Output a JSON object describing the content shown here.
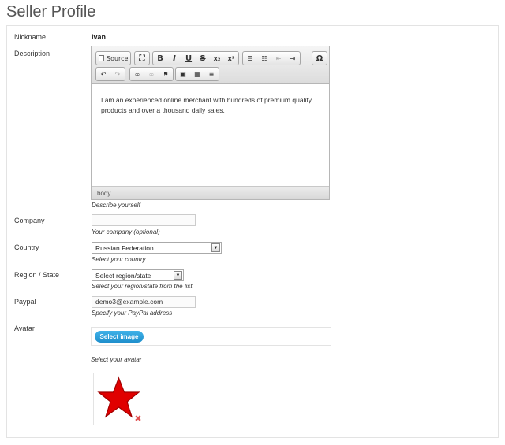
{
  "page": {
    "title": "Seller Profile"
  },
  "nickname": {
    "label": "Nickname",
    "value": "Ivan"
  },
  "description": {
    "label": "Description",
    "hint": "Describe yourself",
    "body_text": "I am an experienced online merchant with hundreds of premium quality products and over a thousand daily sales.",
    "status_path": "body",
    "toolbar": {
      "source_label": "Source",
      "bold": "B",
      "italic": "I",
      "underline": "U",
      "strike": "S",
      "subscript": "x₂",
      "superscript": "x²",
      "special_char": "Ω"
    }
  },
  "company": {
    "label": "Company",
    "value": "",
    "hint": "Your company (optional)"
  },
  "country": {
    "label": "Country",
    "value": "Russian Federation",
    "hint": "Select your country."
  },
  "region": {
    "label": "Region / State",
    "value": "Select region/state",
    "hint": "Select your region/state from the list."
  },
  "paypal": {
    "label": "Paypal",
    "value": "demo3@example.com",
    "hint": "Specify your PayPal address"
  },
  "avatar": {
    "label": "Avatar",
    "button_label": "Select image",
    "hint": "Select your avatar"
  },
  "colors": {
    "accent": "#2a9ad8",
    "star": "#e00000",
    "remove": "#e05050"
  }
}
